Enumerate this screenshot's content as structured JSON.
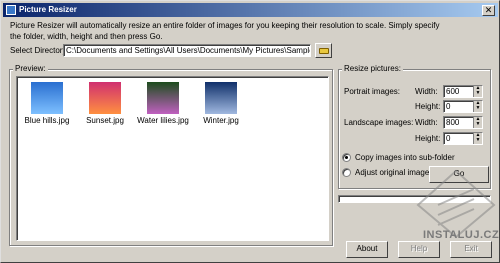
{
  "window": {
    "title": "Picture Resizer",
    "close_label": "✕"
  },
  "description": "Picture Resizer will automatically resize an entire folder of images for you keeping their resolution to scale. Simply specify the folder, width, height and then press Go.",
  "directory": {
    "label": "Select Directory:",
    "value": "C:\\Documents and Settings\\All Users\\Documents\\My Pictures\\Sample Pictures"
  },
  "preview": {
    "label": "Preview:",
    "items": [
      {
        "name": "Blue hills.jpg",
        "colors": [
          "#2a6fd0",
          "#7ec0ff"
        ]
      },
      {
        "name": "Sunset.jpg",
        "colors": [
          "#d03070",
          "#ff9040"
        ]
      },
      {
        "name": "Water lilies.jpg",
        "colors": [
          "#1d4d1d",
          "#c060c0"
        ]
      },
      {
        "name": "Winter.jpg",
        "colors": [
          "#10306a",
          "#a0b8e0"
        ]
      }
    ]
  },
  "resize": {
    "label": "Resize pictures:",
    "portrait_label": "Portrait images:",
    "landscape_label": "Landscape images:",
    "width_label": "Width:",
    "height_label": "Height:",
    "portrait_width": "600",
    "portrait_height": "0",
    "landscape_width": "800",
    "landscape_height": "0",
    "option_copy": "Copy images into sub-folder",
    "option_adjust": "Adjust original images",
    "selected_option": "copy",
    "go_label": "Go",
    "progress": 0
  },
  "buttons": {
    "about": "About",
    "help": "Help",
    "exit": "Exit"
  },
  "watermark": "INSTALUJ.CZ"
}
